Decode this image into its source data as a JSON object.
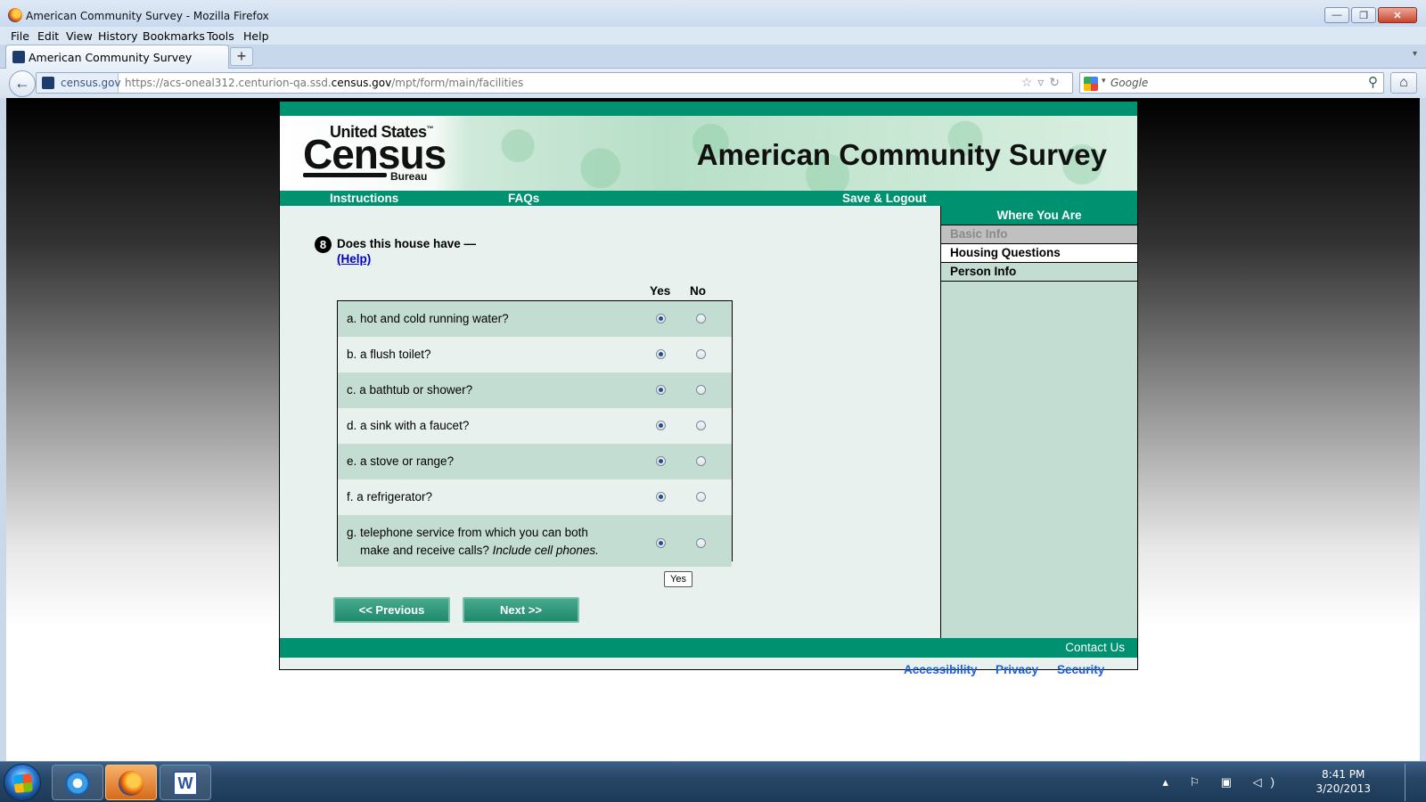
{
  "window": {
    "title": "American Community Survey - Mozilla Firefox",
    "controls": {
      "minimize": "—",
      "maximize": "❐",
      "close": "✕"
    }
  },
  "menu": [
    "File",
    "Edit",
    "View",
    "History",
    "Bookmarks",
    "Tools",
    "Help"
  ],
  "tab": {
    "label": "American Community Survey",
    "new_tab": "+"
  },
  "navbar": {
    "site_identity": "census.gov",
    "url_prefix": "https://acs-oneal312.centurion-qa.ssd.",
    "url_domain": "census.gov",
    "url_suffix": "/mpt/form/main/facilities",
    "search_placeholder": "Google",
    "back_icon": "←",
    "home_icon": "⌂",
    "url_icons": "☆▿↻",
    "search_icon": "⚲"
  },
  "site": {
    "logo": {
      "line1": "United States",
      "tm": "™",
      "line2": "Census",
      "line3": "Bureau"
    },
    "survey_title": "American Community Survey",
    "nav": {
      "instructions": "Instructions",
      "faqs": "FAQs",
      "save_logout": "Save & Logout"
    }
  },
  "sidebar": {
    "heading": "Where You Are",
    "items": [
      {
        "label": "Basic Info",
        "state": "done"
      },
      {
        "label": "Housing Questions",
        "state": "current"
      },
      {
        "label": "Person Info",
        "state": "todo"
      }
    ]
  },
  "question": {
    "number": "8",
    "text": "Does this house have —",
    "help": "(Help)",
    "col_yes": "Yes",
    "col_no": "No",
    "items": [
      {
        "label": "a. hot and cold running water?",
        "answer": "yes"
      },
      {
        "label": "b. a flush toilet?",
        "answer": "yes"
      },
      {
        "label": "c. a bathtub or shower?",
        "answer": "yes"
      },
      {
        "label": "d. a sink with a faucet?",
        "answer": "yes"
      },
      {
        "label": "e. a stove or range?",
        "answer": "yes"
      },
      {
        "label": "f. a refrigerator?",
        "answer": "yes"
      }
    ],
    "last_item": {
      "line1": "g. telephone service from which you can both",
      "line2": "make and receive calls?",
      "line2_italic": "Include cell phones.",
      "answer": "yes"
    },
    "tooltip": "Yes"
  },
  "buttons": {
    "previous": "<<   Previous",
    "next": "Next   >>"
  },
  "footer": {
    "contact": "Contact Us",
    "links": [
      "Accessibility",
      "Privacy",
      "Security"
    ]
  },
  "taskbar": {
    "word_icon": "W",
    "tray_icons": "▴ ⚐ ▣ ◁)",
    "time": "8:41 PM",
    "date": "3/20/2013"
  },
  "colors": {
    "census_green": "#009170",
    "row_green": "#c4ddd2",
    "row_light": "#e8f1ee",
    "link_blue": "#1d5fd6"
  }
}
